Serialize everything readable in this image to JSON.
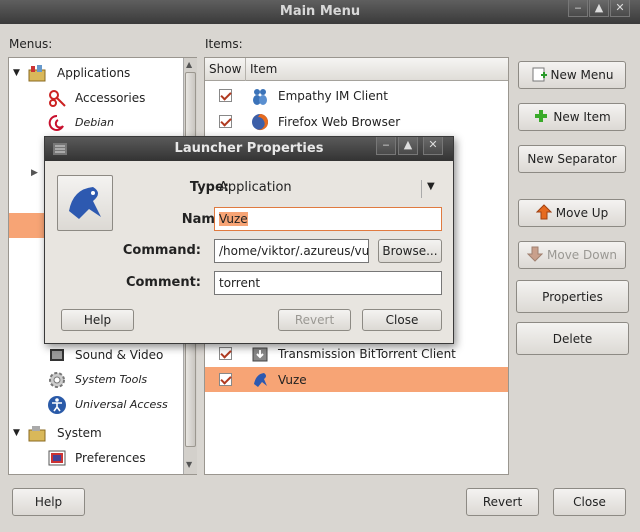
{
  "window": {
    "title": "Main Menu",
    "buttons": [
      "‒",
      "▲",
      "✕"
    ]
  },
  "menus_label": "Menus:",
  "items_label": "Items:",
  "menus": {
    "items": [
      {
        "label": "Applications",
        "expander": "▼",
        "icon": "applications-icon",
        "italic": false
      },
      {
        "label": "Accessories",
        "icon": "accessories-icon",
        "italic": false
      },
      {
        "label": "Debian",
        "icon": "debian-icon",
        "italic": true
      },
      {
        "label": "Sound & Video",
        "icon": "sound-video-icon",
        "italic": false
      },
      {
        "label": "System Tools",
        "icon": "system-tools-icon",
        "italic": true
      },
      {
        "label": "Universal Access",
        "icon": "universal-access-icon",
        "italic": true
      },
      {
        "label": "System",
        "expander": "▼",
        "icon": "system-icon",
        "italic": false
      },
      {
        "label": "Preferences",
        "icon": "preferences-icon",
        "italic": false
      }
    ]
  },
  "items": {
    "headers": [
      "Show",
      "Item"
    ],
    "rows": [
      {
        "label": "Empathy IM Client",
        "checked": true,
        "icon": "empathy-icon"
      },
      {
        "label": "Firefox Web Browser",
        "checked": true,
        "icon": "firefox-icon"
      },
      {
        "label": "Transmission BitTorrent Client",
        "checked": true,
        "icon": "transmission-icon"
      },
      {
        "label": "Vuze",
        "checked": true,
        "icon": "vuze-icon",
        "selected": true
      }
    ]
  },
  "side_buttons": {
    "new_menu": "New Menu",
    "new_item": "New Item",
    "new_separator": "New Separator",
    "move_up": "Move Up",
    "move_down": "Move Down",
    "properties": "Properties",
    "delete": "Delete"
  },
  "bottom_buttons": {
    "help": "Help",
    "revert": "Revert",
    "close": "Close"
  },
  "dialog": {
    "title": "Launcher Properties",
    "buttons": [
      "‒",
      "▲",
      "✕"
    ],
    "type_label": "Type:",
    "type_value": "Application",
    "name_label": "Name:",
    "name_value": "Vuze",
    "command_label": "Command:",
    "command_value": "/home/viktor/.azureus/vu",
    "browse": "Browse...",
    "comment_label": "Comment:",
    "comment_value": "torrent",
    "help": "Help",
    "revert": "Revert",
    "close": "Close"
  },
  "colors": {
    "selection": "#f7a475",
    "titlebar": "#3a3a3a"
  }
}
